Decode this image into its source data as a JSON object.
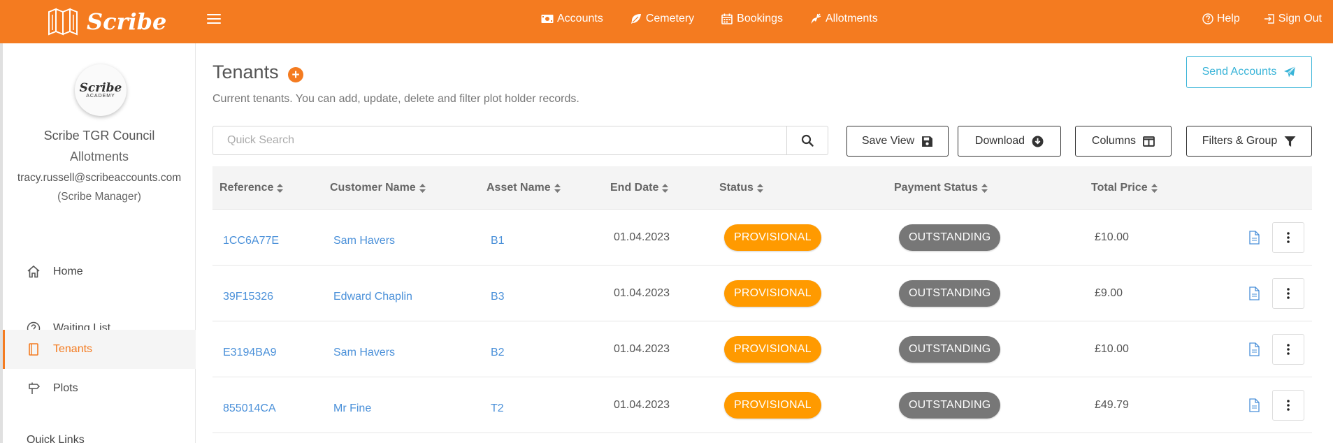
{
  "brand": {
    "name": "Scribe"
  },
  "topnav": [
    {
      "label": "Accounts",
      "icon": "money-icon"
    },
    {
      "label": "Cemetery",
      "icon": "leaf-icon"
    },
    {
      "label": "Bookings",
      "icon": "calendar-icon"
    },
    {
      "label": "Allotments",
      "icon": "carrot-icon"
    }
  ],
  "topright": {
    "help": "Help",
    "signout": "Sign Out"
  },
  "sidebar": {
    "logo_text": "Scribe",
    "logo_sub": "ACADEMY",
    "org_name": "Scribe TGR Council",
    "org_sub": "Allotments",
    "email": "tracy.russell@scribeaccounts.com",
    "role": "(Scribe Manager)",
    "items": [
      {
        "label": "Home",
        "icon": "home-icon"
      },
      {
        "label": "Waiting List",
        "icon": "question-circle-icon"
      },
      {
        "label": "Tenants",
        "icon": "book-icon"
      },
      {
        "label": "Plots",
        "icon": "signpost-icon"
      }
    ],
    "partial_item": "Quick Links"
  },
  "main": {
    "title": "Tenants",
    "description": "Current tenants. You can add, update, delete and filter plot holder records.",
    "send_accounts": "Send Accounts",
    "search_placeholder": "Quick Search",
    "buttons": {
      "save_view": "Save View",
      "download": "Download",
      "columns": "Columns",
      "filters": "Filters & Group"
    }
  },
  "colors": {
    "brand": "#f47b20",
    "accent": "#39b4d8",
    "provisional": "#ff9a00",
    "outstanding": "#777777",
    "link": "#4a90d9"
  },
  "table": {
    "columns": [
      "Reference",
      "Customer Name",
      "Asset Name",
      "End Date",
      "Status",
      "Payment Status",
      "Total Price"
    ],
    "rows": [
      {
        "reference": "1CC6A77E",
        "customer": "Sam Havers",
        "asset": "B1",
        "end_date": "01.04.2023",
        "status": "PROVISIONAL",
        "payment": "OUTSTANDING",
        "total": "£10.00"
      },
      {
        "reference": "39F15326",
        "customer": "Edward Chaplin",
        "asset": "B3",
        "end_date": "01.04.2023",
        "status": "PROVISIONAL",
        "payment": "OUTSTANDING",
        "total": "£9.00"
      },
      {
        "reference": "E3194BA9",
        "customer": "Sam Havers",
        "asset": "B2",
        "end_date": "01.04.2023",
        "status": "PROVISIONAL",
        "payment": "OUTSTANDING",
        "total": "£10.00"
      },
      {
        "reference": "855014CA",
        "customer": "Mr Fine",
        "asset": "T2",
        "end_date": "01.04.2023",
        "status": "PROVISIONAL",
        "payment": "OUTSTANDING",
        "total": "£49.79"
      }
    ]
  }
}
